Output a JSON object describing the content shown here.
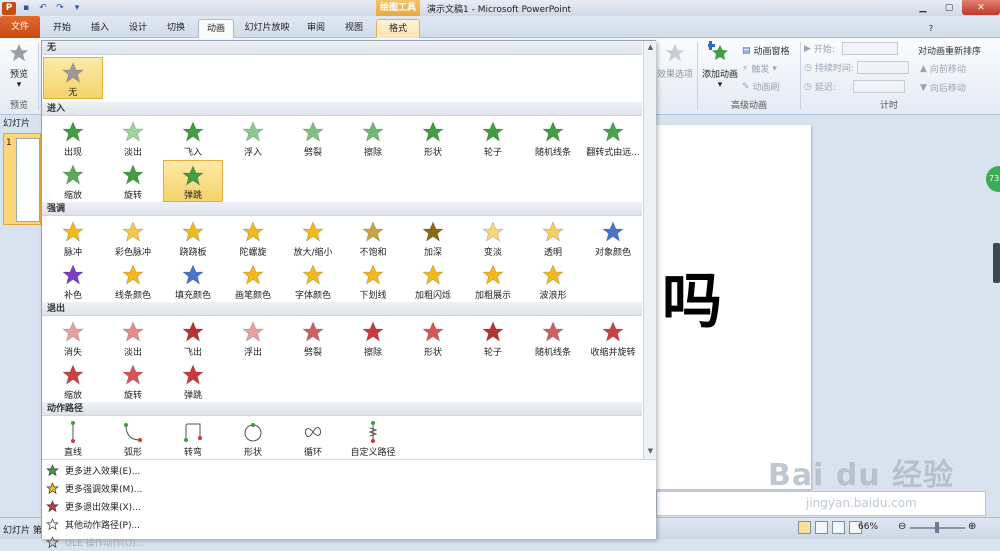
{
  "titlebar": {
    "context_tool": "绘图工具",
    "document_title": "演示文稿1 - Microsoft PowerPoint",
    "qat": [
      "save",
      "undo",
      "redo",
      "customize"
    ],
    "window_controls": [
      "minimize",
      "maximize",
      "close"
    ]
  },
  "tabs": [
    "文件",
    "开始",
    "插入",
    "设计",
    "切换",
    "动画",
    "幻灯片放映",
    "审阅",
    "视图",
    "格式"
  ],
  "active_tab": "动画",
  "ribbon": {
    "preview_label": "预览",
    "preview_group": "预览",
    "effect_options": "效果选项",
    "add_animation": "添加动画",
    "animation_pane": "动画窗格",
    "trigger": "触发",
    "animation_painter": "动画刷",
    "advanced_group": "高级动画",
    "start_label": "开始:",
    "duration_label": "持续时间:",
    "delay_label": "延迟:",
    "timing_group": "计时",
    "reorder_title": "对动画重新排序",
    "move_earlier": "向前移动",
    "move_later": "向后移动"
  },
  "left_panel": {
    "tab": "幻灯片",
    "slide_number": "1"
  },
  "slide": {
    "text": "吗"
  },
  "badge": "73",
  "gallery": {
    "sections": {
      "none": "无",
      "entrance": "进入",
      "emphasis": "强调",
      "exit": "退出",
      "path": "动作路径"
    },
    "none_items": [
      {
        "label": "无",
        "color": "#9a9a9a",
        "selected": true
      }
    ],
    "entrance_items": [
      {
        "label": "出现",
        "color": "#3f9e3f"
      },
      {
        "label": "淡出",
        "color": "#9fd39f"
      },
      {
        "label": "飞入",
        "color": "#3f9e3f"
      },
      {
        "label": "浮入",
        "color": "#8fc98f"
      },
      {
        "label": "劈裂",
        "color": "#7fbf7f"
      },
      {
        "label": "擦除",
        "color": "#6fb86f"
      },
      {
        "label": "形状",
        "color": "#3f9e3f"
      },
      {
        "label": "轮子",
        "color": "#3f9e3f"
      },
      {
        "label": "随机线条",
        "color": "#3f9e3f"
      },
      {
        "label": "翻转式由远...",
        "color": "#4aa34a"
      },
      {
        "label": "缩放",
        "color": "#5aa95a"
      },
      {
        "label": "旋转",
        "color": "#3f9e3f"
      },
      {
        "label": "弹跳",
        "color": "#3f9e3f",
        "selected": true
      }
    ],
    "emphasis_items": [
      {
        "label": "脉冲",
        "color": "#f0b91f"
      },
      {
        "label": "彩色脉冲",
        "color": "#f3c74a"
      },
      {
        "label": "跷跷板",
        "color": "#f0b91f"
      },
      {
        "label": "陀螺旋",
        "color": "#f0b91f"
      },
      {
        "label": "放大/缩小",
        "color": "#f0b91f"
      },
      {
        "label": "不饱和",
        "color": "#c9a446"
      },
      {
        "label": "加深",
        "color": "#8a6a10"
      },
      {
        "label": "变淡",
        "color": "#f7d77a"
      },
      {
        "label": "透明",
        "color": "#f5cf5c"
      },
      {
        "label": "对象颜色",
        "color": "#4a74c8"
      },
      {
        "label": "补色",
        "color": "#7a3fc0"
      },
      {
        "label": "线条颜色",
        "color": "#f0b91f"
      },
      {
        "label": "填充颜色",
        "color": "#4a74c8"
      },
      {
        "label": "画笔颜色",
        "color": "#f0b91f"
      },
      {
        "label": "字体颜色",
        "color": "#f0b91f"
      },
      {
        "label": "下划线",
        "color": "#f0b91f"
      },
      {
        "label": "加粗闪烁",
        "color": "#f0b91f"
      },
      {
        "label": "加粗展示",
        "color": "#f0b91f"
      },
      {
        "label": "波浪形",
        "color": "#f0b91f"
      }
    ],
    "exit_items": [
      {
        "label": "消失",
        "color": "#e9a0a0"
      },
      {
        "label": "淡出",
        "color": "#e68a8a"
      },
      {
        "label": "飞出",
        "color": "#b83232"
      },
      {
        "label": "浮出",
        "color": "#e9a0a0"
      },
      {
        "label": "劈裂",
        "color": "#d06060"
      },
      {
        "label": "擦除",
        "color": "#c83a3a"
      },
      {
        "label": "形状",
        "color": "#d95555"
      },
      {
        "label": "轮子",
        "color": "#b83232"
      },
      {
        "label": "随机线条",
        "color": "#d06060"
      },
      {
        "label": "收缩并旋转",
        "color": "#c84444"
      },
      {
        "label": "缩放",
        "color": "#c84444"
      },
      {
        "label": "旋转",
        "color": "#d95555"
      },
      {
        "label": "弹跳",
        "color": "#c83a3a"
      }
    ],
    "path_items": [
      {
        "label": "直线",
        "shape": "line"
      },
      {
        "label": "弧形",
        "shape": "arc"
      },
      {
        "label": "转弯",
        "shape": "turn"
      },
      {
        "label": "形状",
        "shape": "circle"
      },
      {
        "label": "循环",
        "shape": "loop"
      },
      {
        "label": "自定义路径",
        "shape": "custom"
      }
    ],
    "more": [
      {
        "label": "更多进入效果(E)...",
        "color": "#3f9e3f"
      },
      {
        "label": "更多强调效果(M)...",
        "color": "#f0b91f"
      },
      {
        "label": "更多退出效果(X)...",
        "color": "#c83a3a"
      },
      {
        "label": "其他动作路径(P)...",
        "color": "#ffffff"
      },
      {
        "label": "OLE 操作动作(O)...",
        "color": "#cccccc",
        "disabled": true
      }
    ]
  },
  "status": {
    "left": "幻灯片 第",
    "zoom": "66%"
  },
  "watermark": {
    "logo": "Bai du 经验",
    "url": "jingyan.baidu.com"
  }
}
